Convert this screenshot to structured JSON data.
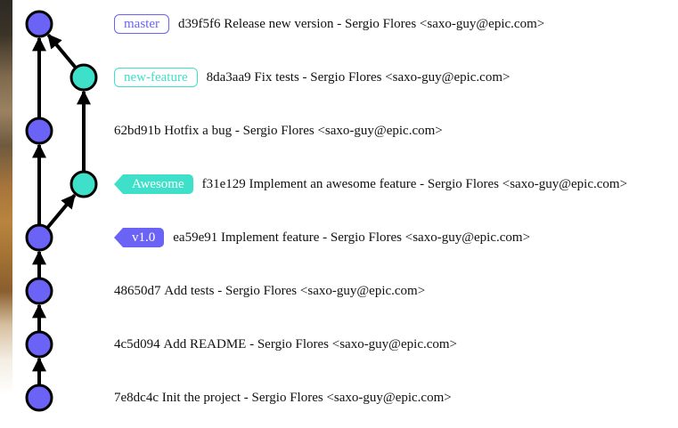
{
  "colors": {
    "purple": "#6b63f5",
    "teal": "#3fe0c9",
    "edge": "#000000"
  },
  "branches": [
    "master",
    "new-feature"
  ],
  "commits": [
    {
      "hash": "d39f5f6",
      "message": "Release new version",
      "author": "Sergio Flores <saxo-guy@epic.com>",
      "branch": "master",
      "tag": {
        "text": "master",
        "style": "outline",
        "color": "#6b63f5"
      }
    },
    {
      "hash": "8da3aa9",
      "message": "Fix tests",
      "author": "Sergio Flores <saxo-guy@epic.com>",
      "branch": "new-feature",
      "tag": {
        "text": "new-feature",
        "style": "outline",
        "color": "#3fe0c9"
      }
    },
    {
      "hash": "62bd91b",
      "message": "Hotfix a bug",
      "author": "Sergio Flores <saxo-guy@epic.com>",
      "branch": "master",
      "tag": null
    },
    {
      "hash": "f31e129",
      "message": "Implement an awesome feature",
      "author": "Sergio Flores <saxo-guy@epic.com>",
      "branch": "new-feature",
      "tag": {
        "text": "Awesome",
        "style": "filled",
        "color": "#3fe0c9"
      }
    },
    {
      "hash": "ea59e91",
      "message": "Implement feature",
      "author": "Sergio Flores <saxo-guy@epic.com>",
      "branch": "master",
      "tag": {
        "text": "v1.0",
        "style": "filled",
        "color": "#6b63f5"
      }
    },
    {
      "hash": "48650d7",
      "message": "Add tests",
      "author": "Sergio Flores <saxo-guy@epic.com>",
      "branch": "master",
      "tag": null
    },
    {
      "hash": "4c5d094",
      "message": "Add README",
      "author": "Sergio Flores <saxo-guy@epic.com>",
      "branch": "master",
      "tag": null
    },
    {
      "hash": "7e8dc4c",
      "message": "Init the project",
      "author": "Sergio Flores <saxo-guy@epic.com>",
      "branch": "master",
      "tag": null
    }
  ],
  "edges": [
    {
      "from": 1,
      "to": 0
    },
    {
      "from": 2,
      "to": 0
    },
    {
      "from": 3,
      "to": 1
    },
    {
      "from": 4,
      "to": 2
    },
    {
      "from": 4,
      "to": 3
    },
    {
      "from": 5,
      "to": 4
    },
    {
      "from": 6,
      "to": 5
    },
    {
      "from": 7,
      "to": 6
    }
  ]
}
